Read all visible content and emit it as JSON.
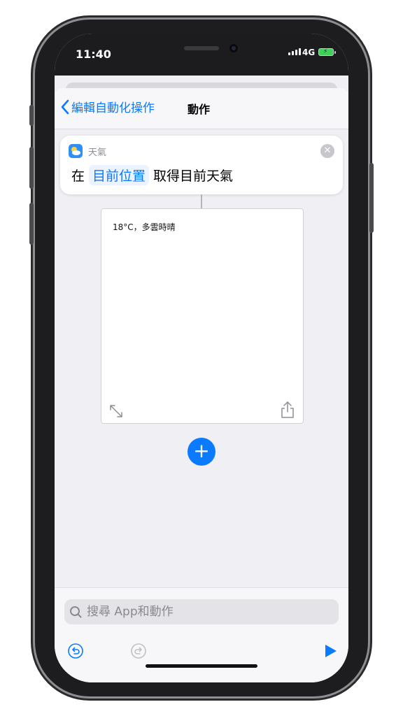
{
  "status_bar": {
    "time": "11:40",
    "network": "4G"
  },
  "nav": {
    "back_label": "編輯自動化操作",
    "title": "動作"
  },
  "action": {
    "app_name": "天氣",
    "sentence_prefix": "在",
    "location_token": "目前位置",
    "sentence_suffix": "取得目前天氣"
  },
  "result": {
    "text": "18°C，多雲時晴"
  },
  "search": {
    "placeholder": "搜尋 App和動作",
    "value": ""
  },
  "colors": {
    "accent": "#0a7aff",
    "play": "#0a7aff"
  },
  "icons": {
    "back": "chevron-left-icon",
    "close": "clear-icon",
    "expand": "expand-icon",
    "share": "share-icon",
    "add": "plus-icon",
    "undo": "undo-icon",
    "redo": "redo-icon",
    "run": "play-icon",
    "search": "search-icon",
    "weather": "weather-app-icon"
  }
}
